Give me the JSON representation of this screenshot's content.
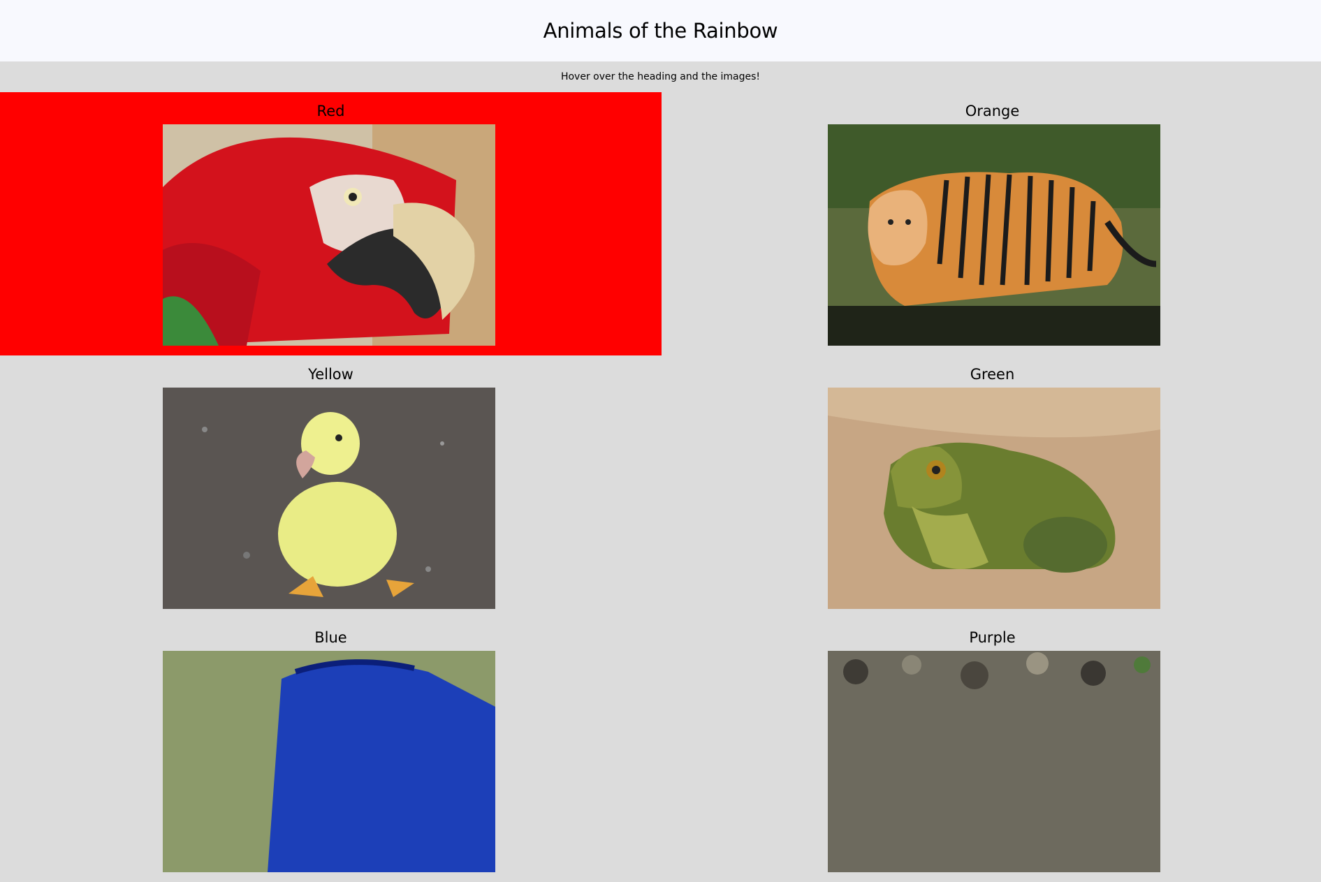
{
  "page": {
    "title": "Animals of the Rainbow",
    "hint": "Hover over the heading and the images!"
  },
  "cards": [
    {
      "heading": "Red",
      "image": "red-macaw-photo",
      "highlight": "#ff0000"
    },
    {
      "heading": "Orange",
      "image": "tiger-photo"
    },
    {
      "heading": "Yellow",
      "image": "duckling-photo"
    },
    {
      "heading": "Green",
      "image": "frog-photo"
    },
    {
      "heading": "Blue",
      "image": "blue-animal-photo"
    },
    {
      "heading": "Purple",
      "image": "purple-animal-photo"
    }
  ]
}
